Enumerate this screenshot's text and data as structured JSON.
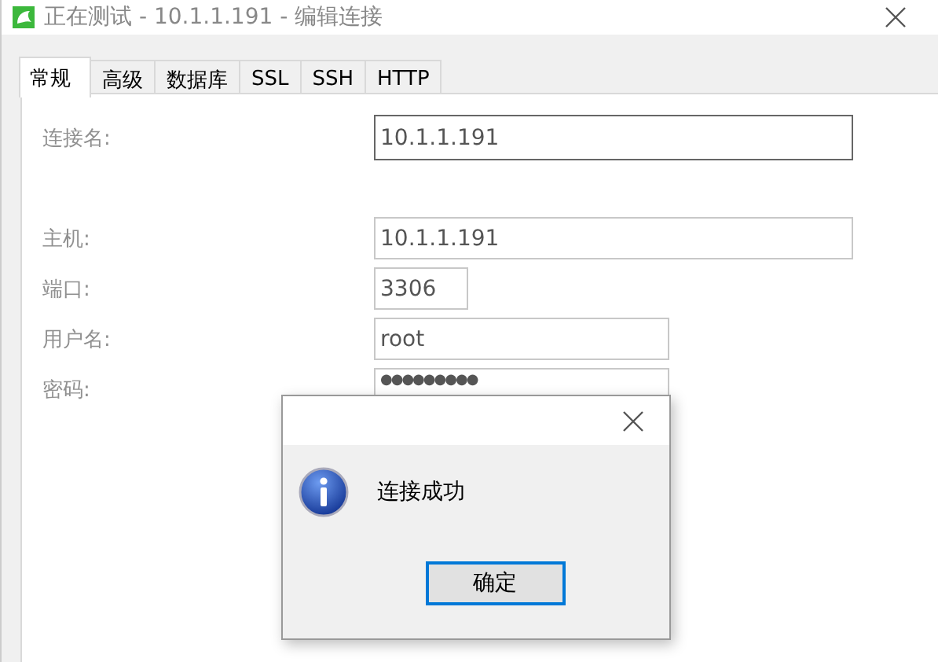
{
  "window": {
    "title": "正在测试 - 10.1.1.191 - 编辑连接"
  },
  "tabs": [
    {
      "label": "常规",
      "selected": true
    },
    {
      "label": "高级",
      "selected": false
    },
    {
      "label": "数据库",
      "selected": false
    },
    {
      "label": "SSL",
      "selected": false
    },
    {
      "label": "SSH",
      "selected": false
    },
    {
      "label": "HTTP",
      "selected": false
    }
  ],
  "field_groups": [
    [
      {
        "label": "连接名:",
        "value": "10.1.1.191",
        "focused": true
      }
    ],
    [
      {
        "label": "主机:",
        "value": "10.1.1.191",
        "focused": false
      },
      {
        "label": "端口:",
        "value": "3306",
        "focused": false
      },
      {
        "label": "用户名:",
        "value": "root",
        "focused": false
      },
      {
        "label": "密码:",
        "value": "●●●●●●●●●",
        "focused": false
      }
    ]
  ],
  "dialog": {
    "message": "连接成功",
    "button": "确定"
  }
}
